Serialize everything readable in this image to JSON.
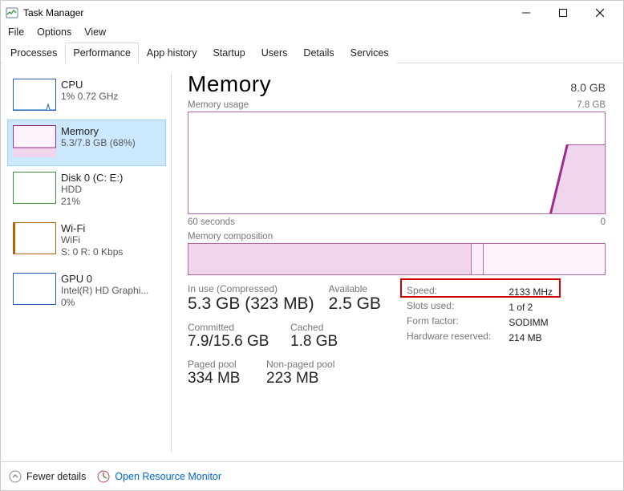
{
  "window": {
    "title": "Task Manager"
  },
  "menu": [
    "File",
    "Options",
    "View"
  ],
  "tabs": [
    "Processes",
    "Performance",
    "App history",
    "Startup",
    "Users",
    "Details",
    "Services"
  ],
  "active_tab": 1,
  "sidebar": {
    "items": [
      {
        "title": "CPU",
        "line2": "1% 0.72 GHz",
        "line3": "",
        "color": "#2463b5"
      },
      {
        "title": "Memory",
        "line2": "5.3/7.8 GB (68%)",
        "line3": "",
        "color": "#9b2d8e"
      },
      {
        "title": "Disk 0 (C: E:)",
        "line2": "HDD",
        "line3": "21%",
        "color": "#3a8f3a"
      },
      {
        "title": "Wi-Fi",
        "line2": "WiFi",
        "line3": "S: 0 R: 0 Kbps",
        "color": "#b06500"
      },
      {
        "title": "GPU 0",
        "line2": "Intel(R) HD Graphi...",
        "line3": "0%",
        "color": "#2463b5"
      }
    ],
    "selected": 1
  },
  "headline": {
    "title": "Memory",
    "capacity": "8.0 GB"
  },
  "usage": {
    "label": "Memory usage",
    "max": "7.8 GB",
    "axis_left": "60 seconds",
    "axis_right": "0"
  },
  "composition": {
    "label": "Memory composition"
  },
  "stats": {
    "inuse_lbl": "In use (Compressed)",
    "inuse_val": "5.3 GB (323 MB)",
    "avail_lbl": "Available",
    "avail_val": "2.5 GB",
    "committed_lbl": "Committed",
    "committed_val": "7.9/15.6 GB",
    "cached_lbl": "Cached",
    "cached_val": "1.8 GB",
    "paged_lbl": "Paged pool",
    "paged_val": "334 MB",
    "nonpaged_lbl": "Non-paged pool",
    "nonpaged_val": "223 MB"
  },
  "hw": {
    "speed_lbl": "Speed:",
    "speed_val": "2133 MHz",
    "slots_lbl": "Slots used:",
    "slots_val": "1 of 2",
    "form_lbl": "Form factor:",
    "form_val": "SODIMM",
    "reserved_lbl": "Hardware reserved:",
    "reserved_val": "214 MB"
  },
  "footer": {
    "fewer": "Fewer details",
    "orm": "Open Resource Monitor"
  },
  "chart_data": {
    "type": "area",
    "title": "Memory usage",
    "xlabel": "seconds ago",
    "ylabel": "GB",
    "xlim": [
      60,
      0
    ],
    "ylim": [
      0,
      7.8
    ],
    "series": [
      {
        "name": "In use",
        "x": [
          60,
          8,
          3,
          0
        ],
        "values": [
          0,
          0,
          5.3,
          5.3
        ]
      }
    ],
    "composition": {
      "inuse_pct": 68,
      "modified_pct": 3,
      "standby_pct": 29
    }
  }
}
